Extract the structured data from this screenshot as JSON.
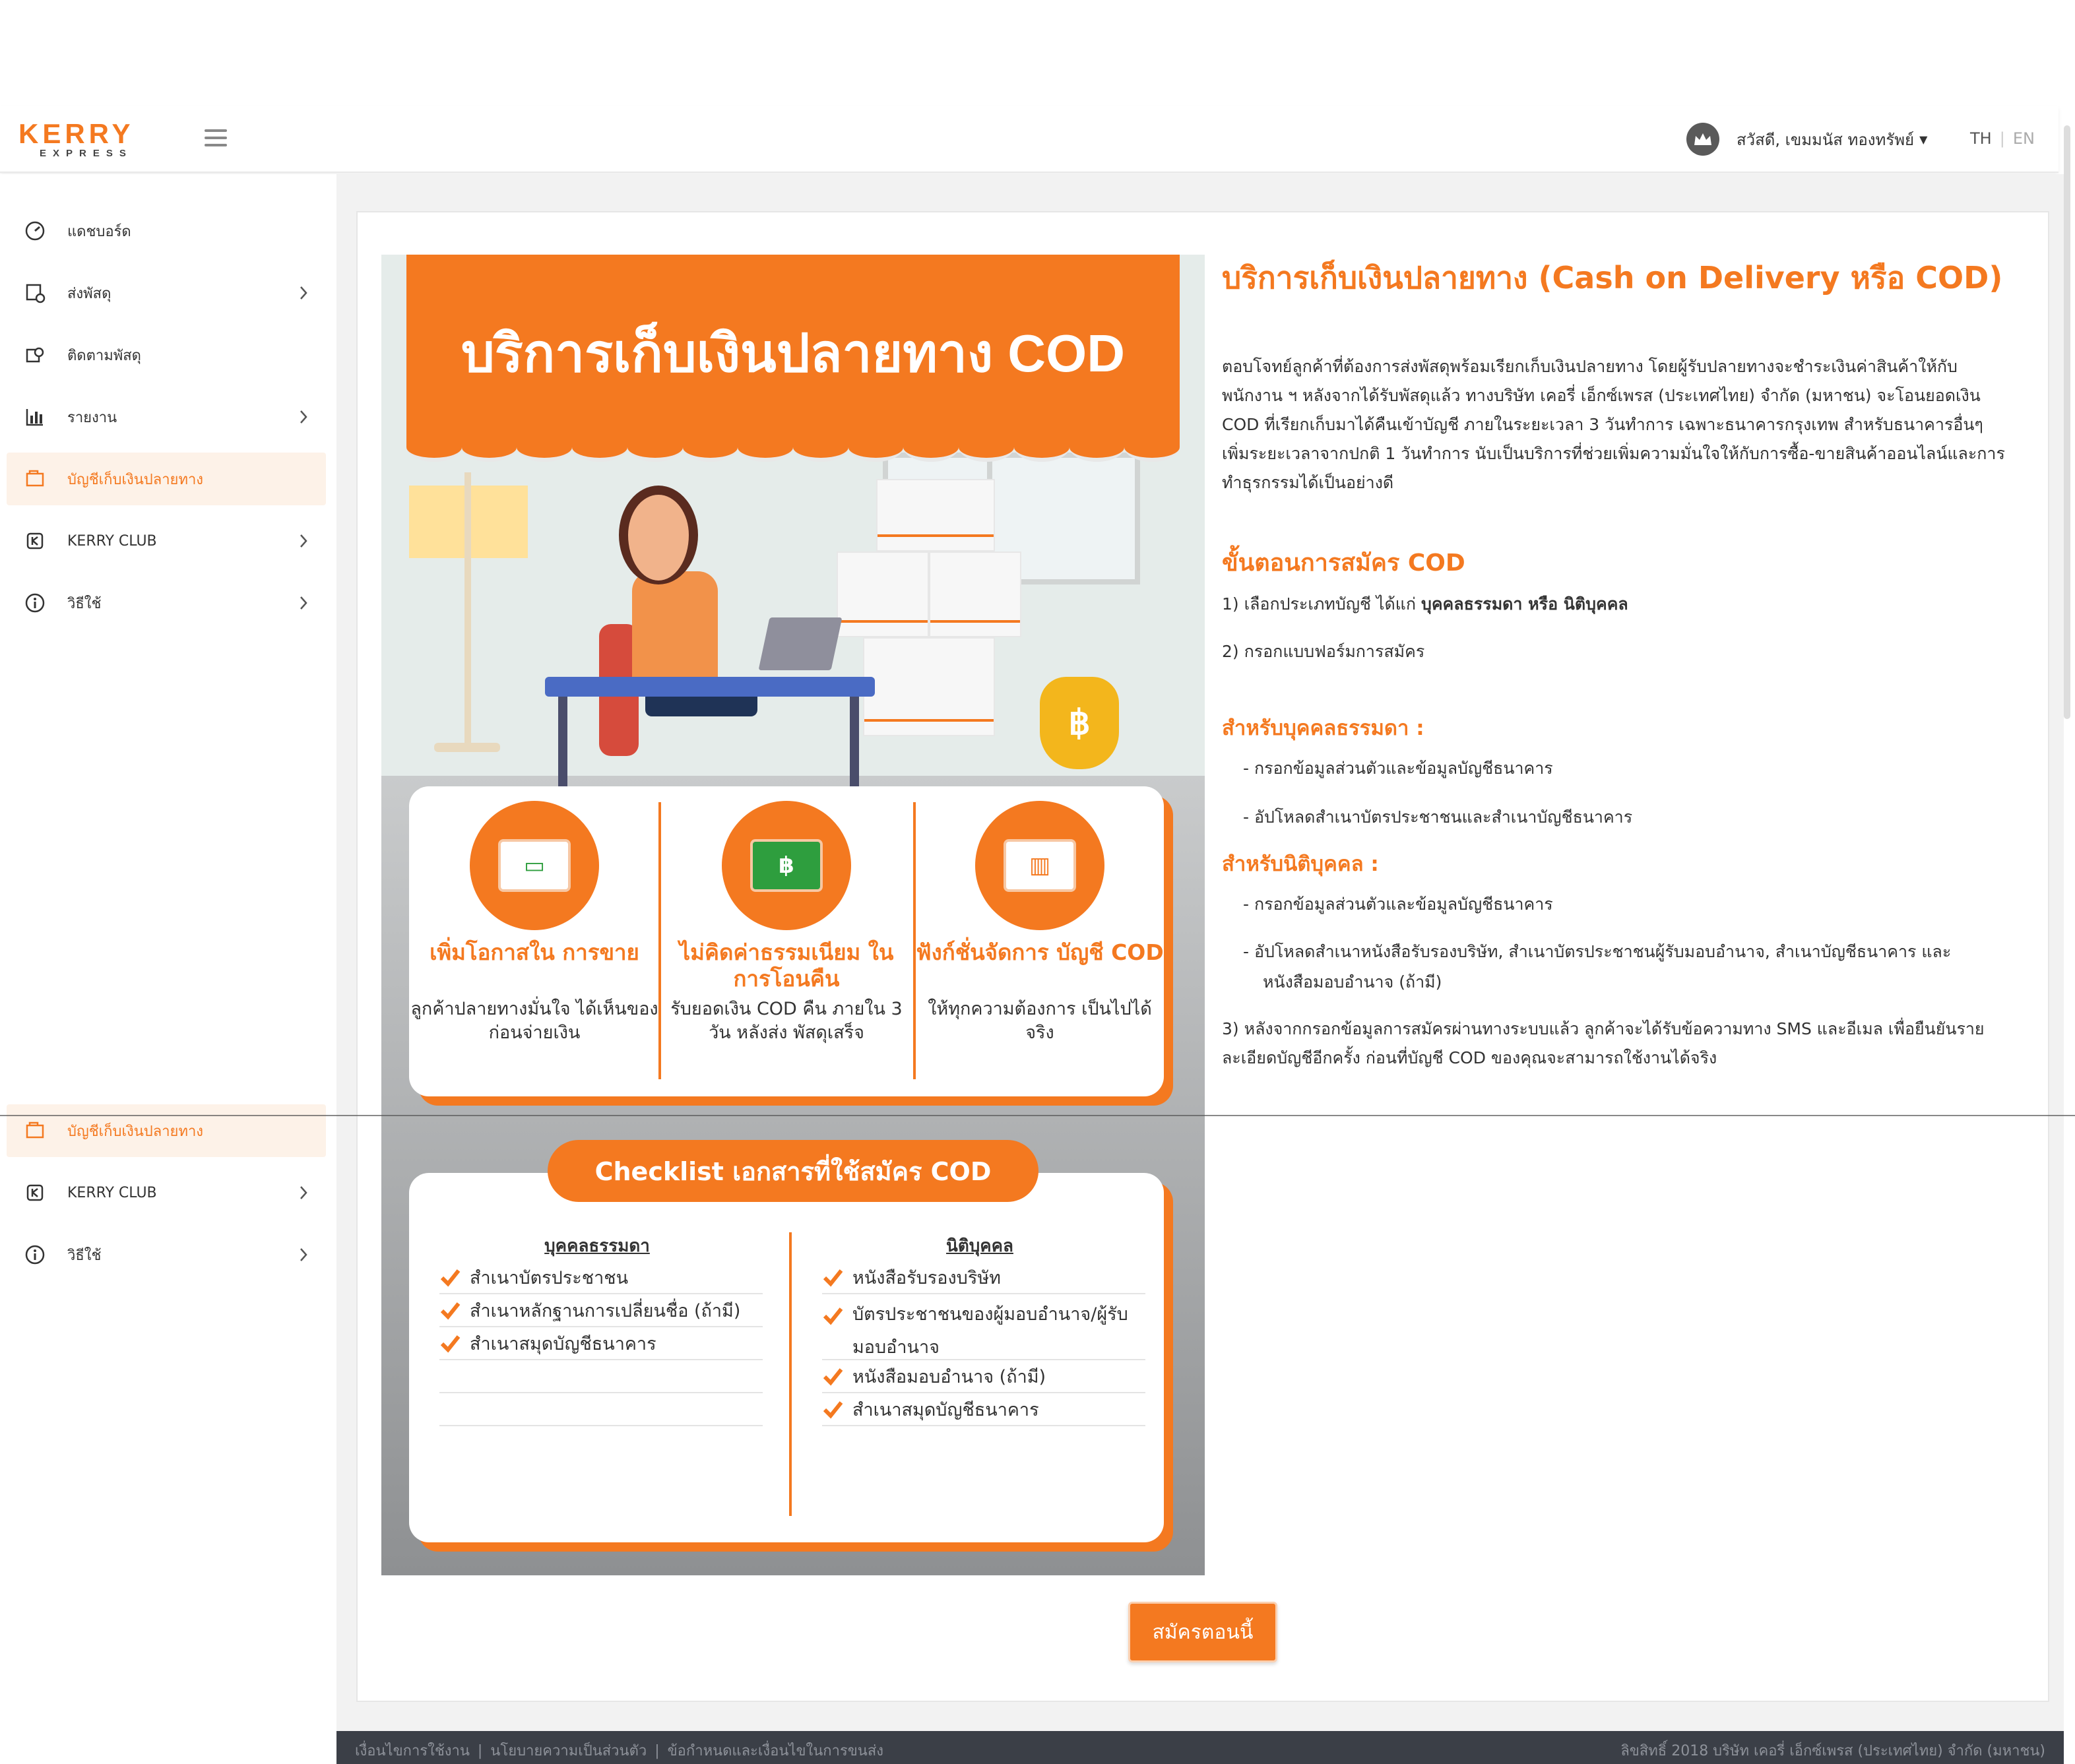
{
  "header": {
    "logo_main": "KERRY",
    "logo_sub": "EXPRESS",
    "user_greeting": "สวัสดี, เขมมนัส ทองทรัพย์",
    "lang_th": "TH",
    "lang_en": "EN",
    "accent_color": "#f47920"
  },
  "sidebar": {
    "items": [
      {
        "label": "แดชบอร์ด",
        "icon": "dashboard-gauge-icon",
        "has_submenu": false
      },
      {
        "label": "ส่งพัสดุ",
        "icon": "send-parcel-icon",
        "has_submenu": true
      },
      {
        "label": "ติดตามพัสดุ",
        "icon": "track-parcel-icon",
        "has_submenu": false
      },
      {
        "label": "รายงาน",
        "icon": "report-chart-icon",
        "has_submenu": true
      },
      {
        "label": "บัญชีเก็บเงินปลายทาง",
        "icon": "cod-account-icon",
        "has_submenu": false,
        "active": true
      },
      {
        "label": "KERRY CLUB",
        "icon": "kerry-club-icon",
        "has_submenu": true
      },
      {
        "label": "วิธีใช้",
        "icon": "info-icon",
        "has_submenu": true
      }
    ],
    "repeat_items": [
      {
        "label": "บัญชีเก็บเงินปลายทาง",
        "icon": "cod-account-icon",
        "active": true
      },
      {
        "label": "KERRY CLUB",
        "icon": "kerry-club-icon"
      },
      {
        "label": "วิธีใช้",
        "icon": "info-icon"
      }
    ]
  },
  "banner": {
    "title": "บริการเก็บเงินปลายทาง COD",
    "features": [
      {
        "title": "เพิ่มโอกาสใน การขาย",
        "desc": "ลูกค้าปลายทางมั่นใจ ได้เห็นของก่อนจ่ายเงิน",
        "icon": "parcel-box-icon"
      },
      {
        "title": "ไม่คิดค่าธรรมเนียม ในการโอนคืน",
        "desc": "รับยอดเงิน COD คืน ภายใน 3 วัน หลังส่ง พัสดุเสร็จ",
        "icon": "cash-banknote-icon"
      },
      {
        "title": "ฟังก์ชั่นจัดการ บัญชี COD",
        "desc": "ให้ทุกความต้องการ เป็นไปได้จริง",
        "icon": "monitor-chart-icon"
      }
    ],
    "checklist_title": "Checklist เอกสารที่ใช้สมัคร COD",
    "checklist_individual_title": "บุคคลธรรมดา",
    "checklist_individual": [
      "สำเนาบัตรประชาชน",
      "สำเนาหลักฐานการเปลี่ยนชื่อ (ถ้ามี)",
      "สำเนาสมุดบัญชีธนาคาร"
    ],
    "checklist_company_title": "นิติบุคคล",
    "checklist_company": [
      "หนังสือรับรองบริษัท",
      "บัตรประชาชนของผู้มอบอำนาจ/ผู้รับ มอบอำนาจ",
      "หนังสือมอบอำนาจ (ถ้ามี)",
      "สำเนาสมุดบัญชีธนาคาร"
    ]
  },
  "info": {
    "title": "บริการเก็บเงินปลายทาง (Cash on Delivery หรือ COD)",
    "intro": "ตอบโจทย์ลูกค้าที่ต้องการส่งพัสดุพร้อมเรียกเก็บเงินปลายทาง โดยผู้รับปลายทางจะชำระเงินค่าสินค้าให้กับพนักงาน ฯ หลังจากได้รับพัสดุแล้ว ทางบริษัท เคอรี่ เอ็กซ์เพรส (ประเทศไทย) จำกัด (มหาชน) จะโอนยอดเงิน COD ที่เรียกเก็บมาได้คืนเข้าบัญชี ภายในระยะเวลา 3 วันทำการ เฉพาะธนาคารกรุงเทพ สำหรับธนาคารอื่นๆ เพิ่มระยะเวลาจากปกติ 1 วันทำการ นับเป็นบริการที่ช่วยเพิ่มความมั่นใจให้กับการซื้อ-ขายสินค้าออนไลน์และการทำธุรกรรมได้เป็นอย่างดี",
    "steps_title": "ขั้นตอนการสมัคร COD",
    "step1_prefix": "1) เลือกประเภทบัญชี ได้แก่ ",
    "step1_bold": "บุคคลธรรมดา หรือ นิติบุคคล",
    "step2": "2) กรอกแบบฟอร์มการสมัคร",
    "individual_title": "สำหรับบุคคลธรรมดา :",
    "individual_items": [
      "- กรอกข้อมูลส่วนตัวและข้อมูลบัญชีธนาคาร",
      "- อัปโหลดสำเนาบัตรประชาชนและสำเนาบัญชีธนาคาร"
    ],
    "company_title": "สำหรับนิติบุคคล :",
    "company_items": [
      "- กรอกข้อมูลส่วนตัวและข้อมูลบัญชีธนาคาร",
      "- อัปโหลดสำเนาหนังสือรับรองบริษัท, สำเนาบัตรประชาชนผู้รับมอบอำนาจ, สำเนาบัญชีธนาคาร และหนังสือมอบอำนาจ (ถ้ามี)"
    ],
    "step3": "3) หลังจากกรอกข้อมูลการสมัครผ่านทางระบบแล้ว ลูกค้าจะได้รับข้อความทาง SMS และอีเมล เพื่อยืนยันรายละเอียดบัญชีอีกครั้ง ก่อนที่บัญชี COD ของคุณจะสามารถใช้งานได้จริง"
  },
  "apply_button": "สมัครตอนนี้",
  "footer": {
    "links": [
      "เงื่อนไขการใช้งาน",
      "นโยบายความเป็นส่วนตัว",
      "ข้อกำหนดและเงื่อนไขในการขนส่ง"
    ],
    "copyright": "ลิขสิทธิ์ 2018 บริษัท เคอรี่ เอ็กซ์เพรส (ประเทศไทย) จำกัด (มหาชน)"
  }
}
